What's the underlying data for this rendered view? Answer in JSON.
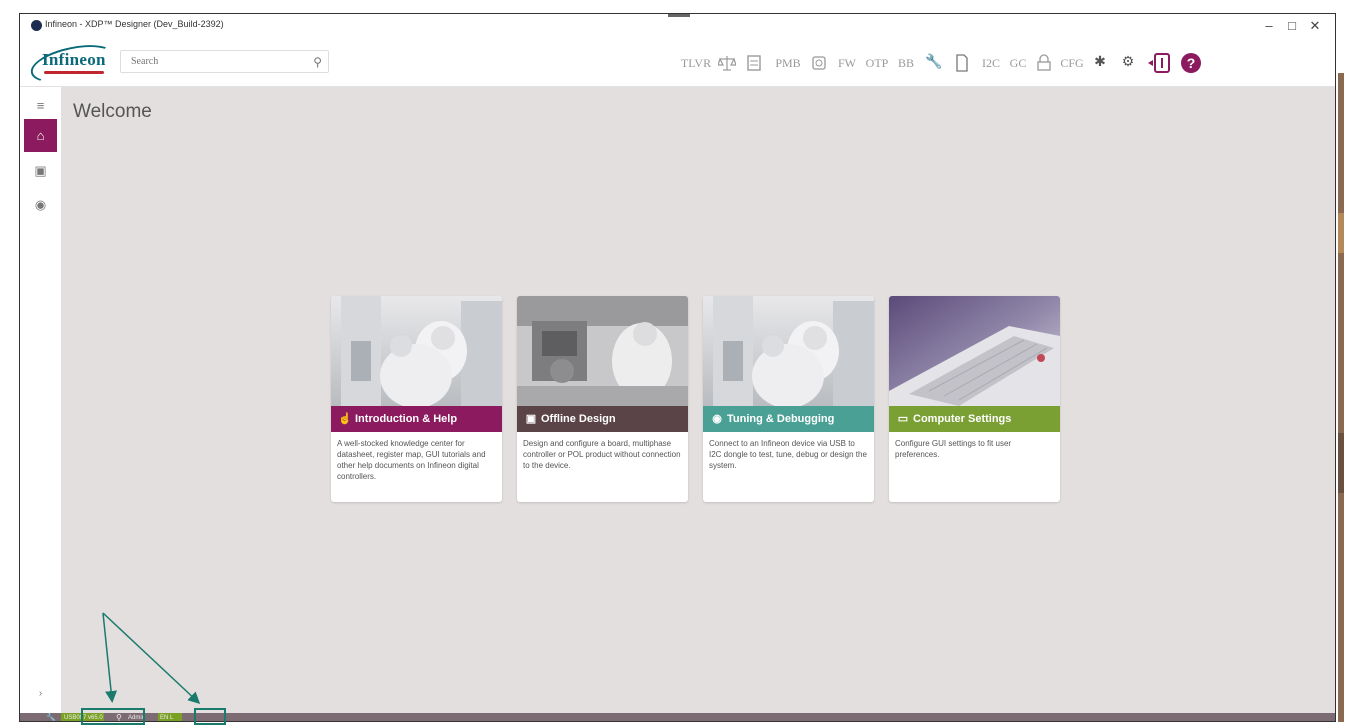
{
  "window": {
    "title": "Infineon - XDP™ Designer (Dev_Build-2392)",
    "controls": [
      "–",
      "□",
      "✕"
    ]
  },
  "header": {
    "logo_text": "Infineon",
    "search": {
      "placeholder": "Search",
      "value": ""
    },
    "toolbar": [
      "TLVR",
      "PMB",
      "FW",
      "OTP",
      "BB",
      "I2C",
      "GC",
      "CFG"
    ],
    "icons": [
      "balance-scale-icon",
      "register-icon",
      "chip-icon",
      "wrench-icon",
      "document-icon",
      "lock-check-icon",
      "bug-icon",
      "gear-icon",
      "login-icon",
      "help-icon"
    ]
  },
  "sidebar": {
    "items": [
      {
        "name": "menu-collapse-icon",
        "glyph": "≡"
      },
      {
        "name": "home-icon",
        "glyph": "⌂"
      },
      {
        "name": "chip-icon",
        "glyph": "▣"
      },
      {
        "name": "target-icon",
        "glyph": "◉"
      }
    ],
    "expand_glyph": "›"
  },
  "main": {
    "title": "Welcome",
    "cards": [
      {
        "title": "Introduction & Help",
        "icon": "hand-pointer-icon",
        "color": "#8b1a5e",
        "description": "A well-stocked knowledge center for datasheet, register map, GUI tutorials and other help documents on Infineon digital controllers."
      },
      {
        "title": "Offline Design",
        "icon": "chip-icon",
        "color": "#5a4448",
        "description": "Design and configure a board, multiphase controller or POL product without connection to the device."
      },
      {
        "title": "Tuning & Debugging",
        "icon": "target-icon",
        "color": "#4ba095",
        "description": "Connect to an Infineon device via USB to I2C dongle to test, tune, debug or design the system."
      },
      {
        "title": "Computer Settings",
        "icon": "laptop-icon",
        "color": "#7a9f33",
        "description": "Configure GUI settings to fit user preferences."
      }
    ]
  },
  "statusbar": {
    "usb": "USB007 v65.0",
    "user": "Admin",
    "lang": "EN L"
  },
  "colors": {
    "accent": "#8b1a5e",
    "highlight_box": "#1a7a6c",
    "content_bg": "#e4dfdf"
  }
}
